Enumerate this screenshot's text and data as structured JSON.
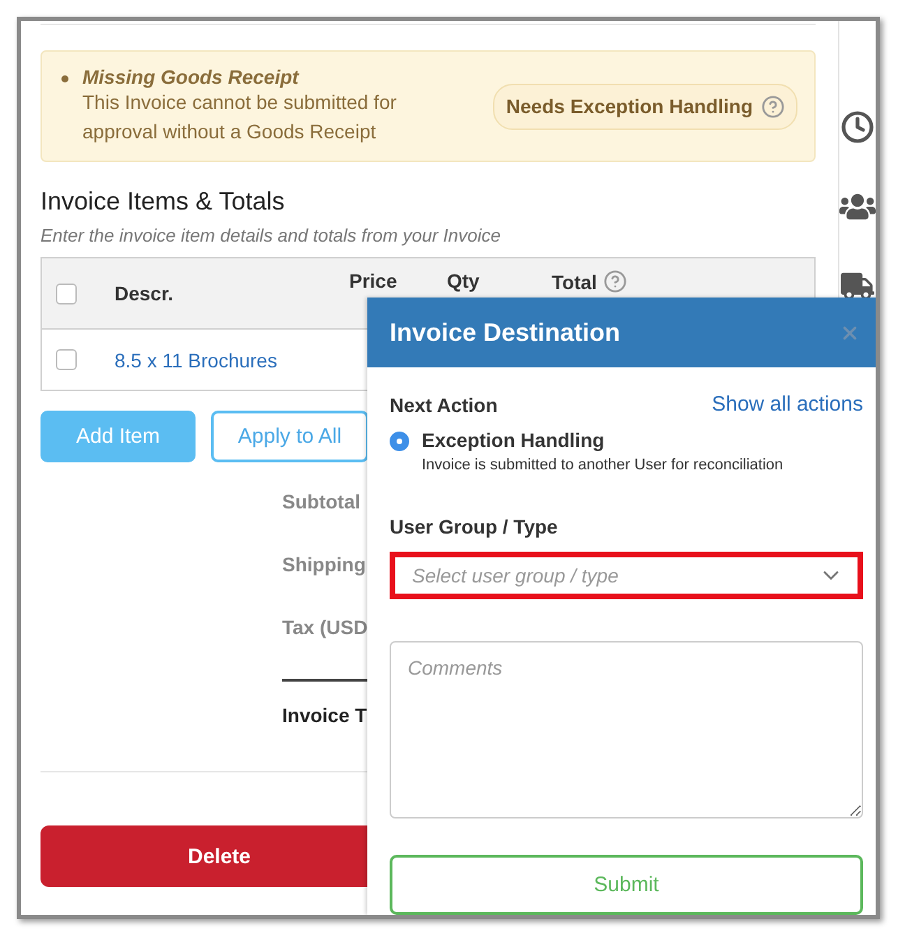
{
  "alert": {
    "title": "Missing Goods Receipt",
    "message": "This Invoice cannot be submitted for approval without a Goods Receipt",
    "badge": "Needs Exception Handling"
  },
  "section": {
    "title": "Invoice Items & Totals",
    "subtitle": "Enter the invoice item details and totals from your Invoice"
  },
  "table": {
    "header_checked": false,
    "columns": [
      {
        "label": "Descr.",
        "help": false
      },
      {
        "label": "Price",
        "help": false
      },
      {
        "label": "Qty",
        "help": false
      },
      {
        "label": "Total",
        "help": true
      }
    ],
    "rows": [
      {
        "description": "8.5 x 11 Brochures",
        "checked": false
      }
    ]
  },
  "buttons": [
    {
      "label": "Add Item",
      "kind": "primary"
    },
    {
      "label": "Apply to All",
      "kind": "outline"
    }
  ],
  "totals": [
    {
      "label": "Subtotal",
      "kind": "line"
    },
    {
      "label": "Shipping",
      "kind": "line"
    },
    {
      "label": "Tax (USD",
      "kind": "line"
    },
    {
      "label": "Invoice T",
      "kind": "total"
    }
  ],
  "delete_button": "Delete",
  "dialog": {
    "title": "Invoice Destination",
    "next_action_label": "Next Action",
    "show_all_link": "Show all actions",
    "options": [
      {
        "label": "Exception Handling",
        "description": "Invoice is submitted to another User for reconciliation",
        "selected": true
      }
    ],
    "user_group_label": "User Group / Type",
    "select": {
      "placeholder": "Select user group / type",
      "highlighted": true
    },
    "comments": {
      "placeholder": "Comments"
    },
    "submit": "Submit"
  }
}
